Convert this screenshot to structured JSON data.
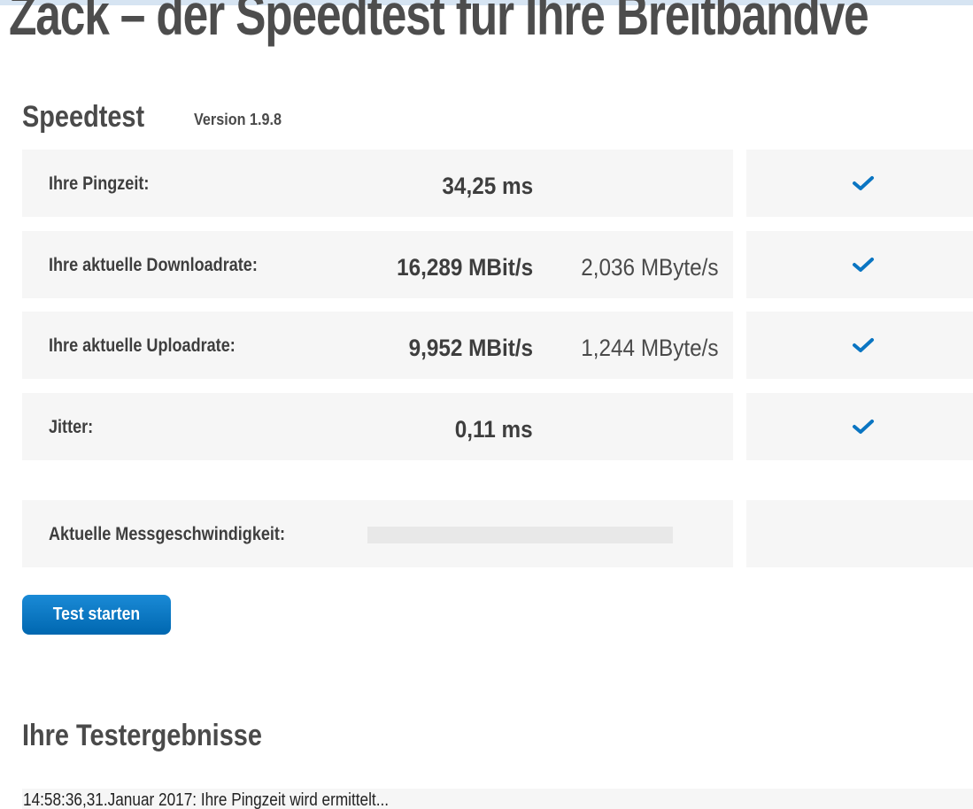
{
  "header": {
    "title": "Zack – der Speedtest für Ihre Breitbandve"
  },
  "speedtest": {
    "title": "Speedtest",
    "version": "Version 1.9.8",
    "rows": [
      {
        "label": "Ihre Pingzeit:",
        "value": "34,25 ms",
        "value_secondary": "",
        "status_icon": "check-icon"
      },
      {
        "label": "Ihre aktuelle Downloadrate:",
        "value": "16,289 MBit/s",
        "value_secondary": "2,036 MByte/s",
        "status_icon": "check-icon"
      },
      {
        "label": "Ihre aktuelle Uploadrate:",
        "value": "9,952 MBit/s",
        "value_secondary": "1,244 MByte/s",
        "status_icon": "check-icon"
      },
      {
        "label": "Jitter:",
        "value": "0,11 ms",
        "value_secondary": "",
        "status_icon": "check-icon"
      }
    ],
    "current_speed": {
      "label": "Aktuelle Messgeschwindigkeit:",
      "progress": 0
    },
    "start_button_label": "Test starten"
  },
  "results": {
    "title": "Ihre Testergebnisse",
    "log": [
      "14:58:36,31.Januar 2017: Ihre Pingzeit wird ermittelt..."
    ]
  },
  "colors": {
    "accent": "#0a75c2",
    "button": "#0067b0",
    "row_background": "#f6f6f6",
    "check": "#0a75c2"
  }
}
